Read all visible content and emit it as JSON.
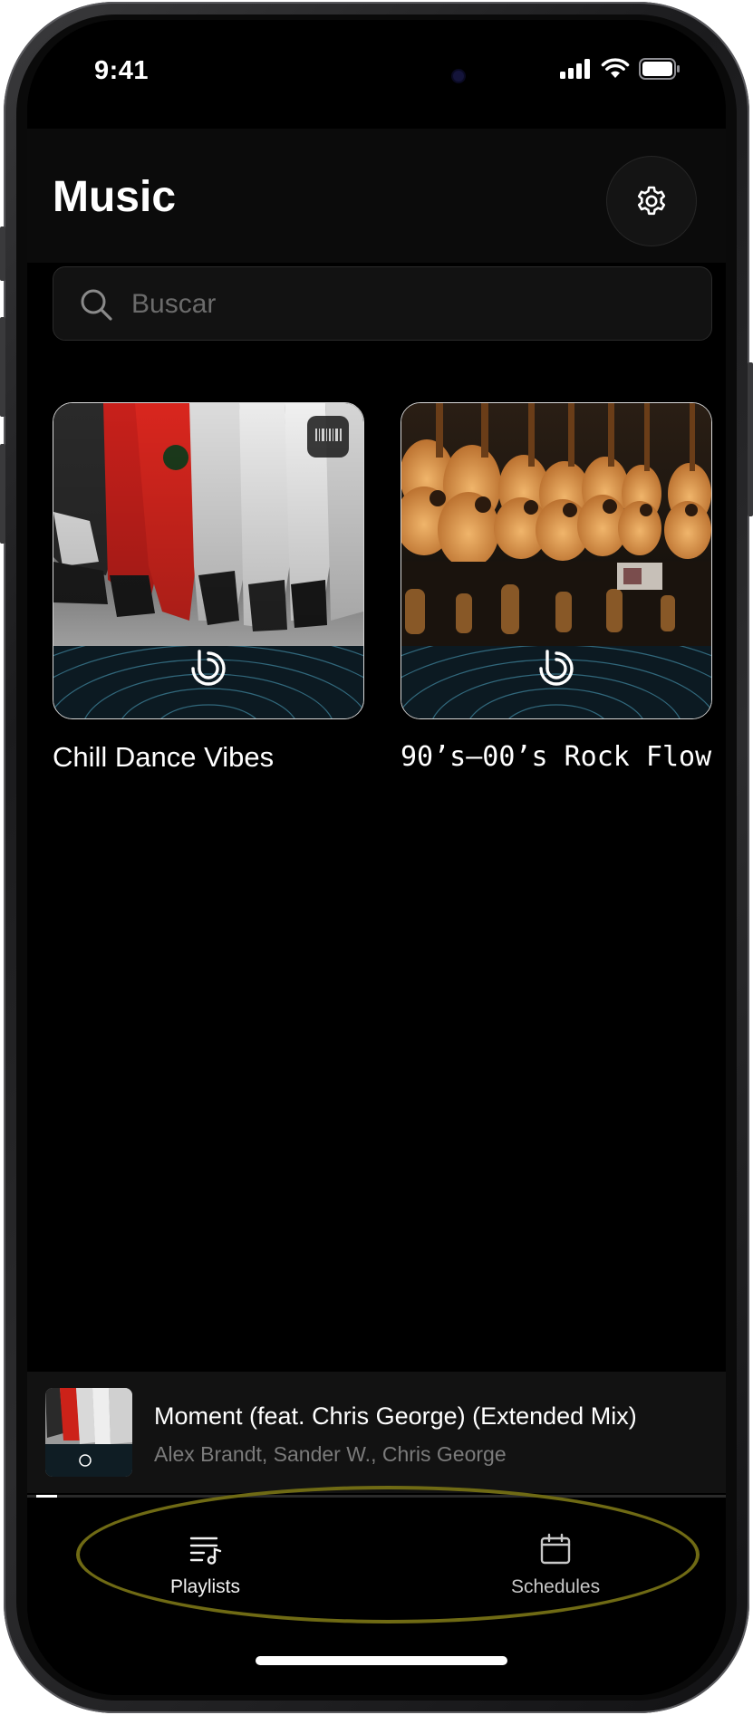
{
  "status_bar": {
    "time": "9:41",
    "icons": [
      "signal-icon",
      "wifi-icon",
      "battery-icon"
    ]
  },
  "header": {
    "title": "Music",
    "settings_icon": "gear-icon"
  },
  "search": {
    "placeholder": "Buscar",
    "value": ""
  },
  "playlists": [
    {
      "title": "Chill Dance Vibes",
      "art": "sneakers-photo"
    },
    {
      "title": "90’s–00’s Rock Flow",
      "art": "guitars-photo"
    }
  ],
  "now_playing": {
    "title": "Moment (feat. Chris George)  (Extended Mix)",
    "artists": "Alex Brandt, Sander W., Chris George",
    "progress": 0.03
  },
  "tabs": [
    {
      "label": "Playlists",
      "icon": "playlist-music-icon"
    },
    {
      "label": "Schedules",
      "icon": "calendar-icon"
    }
  ],
  "colors": {
    "background": "#000000",
    "surface": "#121212",
    "text_primary": "#ffffff",
    "text_secondary": "#7b7b7b",
    "highlight_ring": "#6f6a14"
  }
}
